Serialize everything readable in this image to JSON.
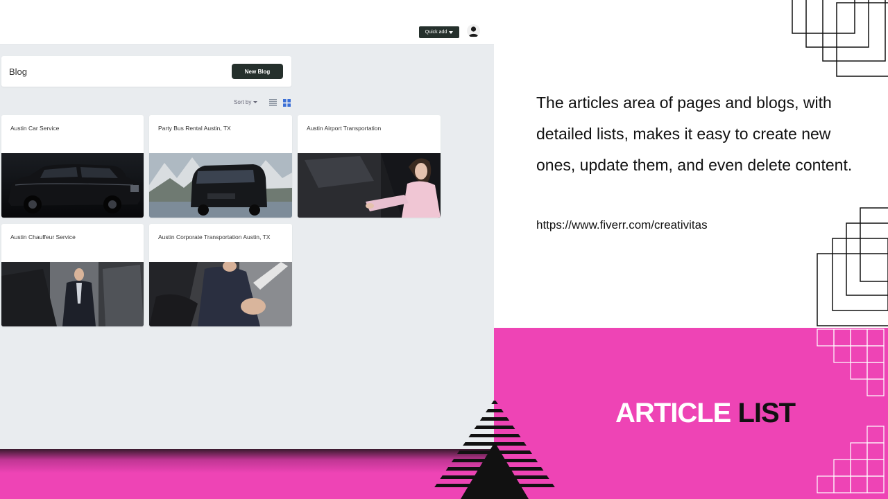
{
  "app": {
    "quick_add_label": "Quick add",
    "blog_title": "Blog",
    "new_blog_label": "New Blog",
    "sort_label": "Sort by",
    "cards": [
      {
        "title": "Austin Car Service",
        "image": "black-suv-photo"
      },
      {
        "title": "Party Bus Rental Austin, TX",
        "image": "black-van-mountains-photo"
      },
      {
        "title": "Austin Airport Transportation",
        "image": "woman-exiting-car-photo"
      },
      {
        "title": "Austin Chauffeur Service",
        "image": "chauffeur-holding-door-photo"
      },
      {
        "title": "Austin Corporate Transportation Austin, TX",
        "image": "businessman-in-car-photo"
      }
    ]
  },
  "panel": {
    "description": "The articles area of pages and blogs, with detailed lists, makes it easy to create new ones, update them, and even delete content.",
    "link": "https://www.fiverr.com/creativitas",
    "headline_part1": "ARTICLE",
    "headline_part2": "LIST"
  },
  "colors": {
    "accent_pink": "#ee44b5",
    "dark_button": "#25302c",
    "app_background": "#e9ecef"
  }
}
